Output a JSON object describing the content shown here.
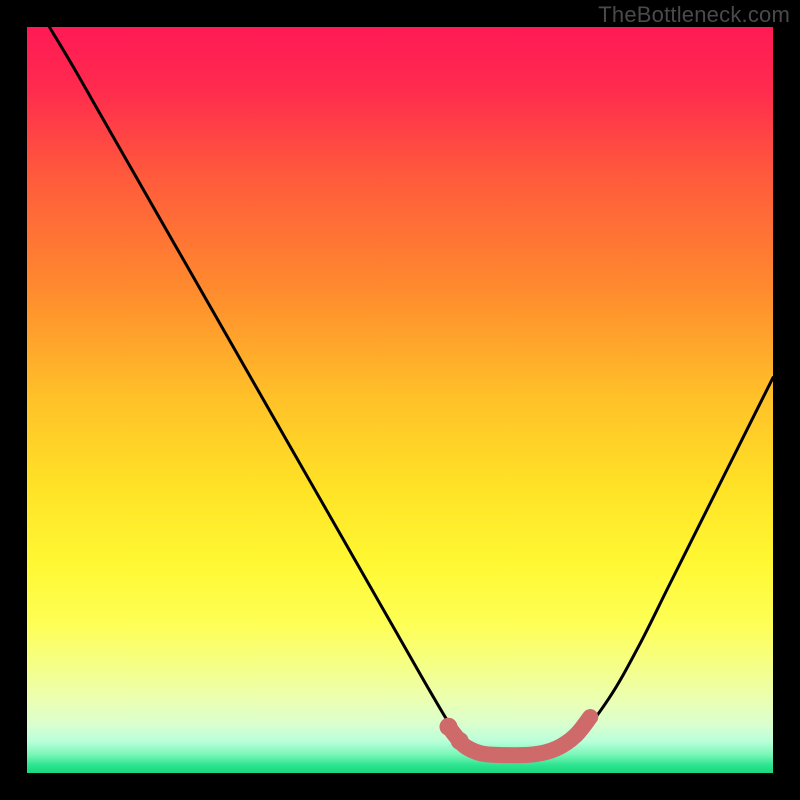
{
  "watermark": "TheBottleneck.com",
  "colors": {
    "gradient_stops": [
      {
        "offset": 0.0,
        "color": "#ff1a55"
      },
      {
        "offset": 0.08,
        "color": "#ff2a4e"
      },
      {
        "offset": 0.2,
        "color": "#ff5a3c"
      },
      {
        "offset": 0.35,
        "color": "#ff8a2e"
      },
      {
        "offset": 0.5,
        "color": "#ffc228"
      },
      {
        "offset": 0.62,
        "color": "#ffe326"
      },
      {
        "offset": 0.72,
        "color": "#fff833"
      },
      {
        "offset": 0.8,
        "color": "#feff55"
      },
      {
        "offset": 0.86,
        "color": "#f4ff8a"
      },
      {
        "offset": 0.905,
        "color": "#eaffb4"
      },
      {
        "offset": 0.935,
        "color": "#d9ffcf"
      },
      {
        "offset": 0.958,
        "color": "#b9ffda"
      },
      {
        "offset": 0.975,
        "color": "#7af7b8"
      },
      {
        "offset": 0.99,
        "color": "#2be38e"
      },
      {
        "offset": 1.0,
        "color": "#18d880"
      }
    ],
    "curve": "#000000",
    "highlight": "#cf6a6a"
  },
  "chart_data": {
    "type": "line",
    "title": "",
    "xlabel": "",
    "ylabel": "",
    "xlim": [
      0,
      100
    ],
    "ylim": [
      0,
      100
    ],
    "series": [
      {
        "name": "bottleneck-curve",
        "x": [
          3,
          6,
          10,
          14,
          18,
          22,
          26,
          30,
          34,
          38,
          42,
          46,
          50,
          54,
          57,
          59,
          61,
          63,
          66,
          70,
          74,
          78,
          82,
          86,
          90,
          94,
          98,
          100
        ],
        "y": [
          100,
          95,
          88,
          81,
          74,
          67,
          60,
          53,
          46,
          39,
          32,
          25,
          18,
          11,
          6,
          3.5,
          2.5,
          2.2,
          2.2,
          2.8,
          5,
          10,
          17,
          25,
          33,
          41,
          49,
          53
        ]
      },
      {
        "name": "highlight-segment",
        "x": [
          56.5,
          58,
          59,
          61,
          64,
          68,
          71,
          73.5,
          75.5
        ],
        "y": [
          6.2,
          4.3,
          3.4,
          2.6,
          2.4,
          2.5,
          3.3,
          5.0,
          7.5
        ]
      }
    ]
  }
}
